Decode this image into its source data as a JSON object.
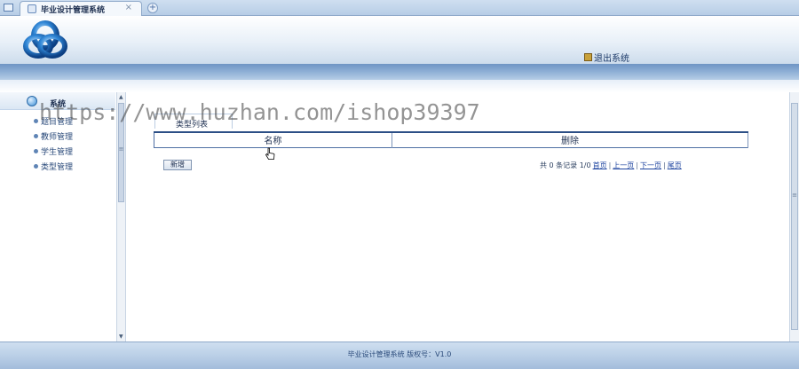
{
  "browser": {
    "tab_title": "毕业设计管理系统",
    "close_glyph": "×",
    "new_tab_glyph": "+"
  },
  "header": {
    "exit_label": "退出系统"
  },
  "sidebar": {
    "section_label": "系统",
    "items": [
      {
        "label": "题目管理"
      },
      {
        "label": "教师管理"
      },
      {
        "label": "学生管理"
      },
      {
        "label": "类型管理"
      }
    ]
  },
  "main": {
    "panel_title": "类型列表",
    "columns": [
      "名称",
      "删除"
    ],
    "add_button": "新增",
    "pager": {
      "summary": "共 0 条记录 1/0",
      "first": "首页",
      "prev": "上一页",
      "next": "下一页",
      "last": "尾页",
      "separator": "|"
    }
  },
  "footer": {
    "text": "毕业设计管理系统  版权号：V1.0"
  },
  "watermark": "https://www.huzhan.com/ishop39397",
  "colors": {
    "accent": "#4f6fa3",
    "header_bar": "#8fb0d6",
    "link": "#1f45a0"
  },
  "icons": [
    "window-icon",
    "favicon-icon",
    "close-icon",
    "new-tab-icon",
    "logo-icon",
    "exit-icon",
    "system-icon",
    "bullet-icon",
    "pointer-cursor-icon"
  ]
}
